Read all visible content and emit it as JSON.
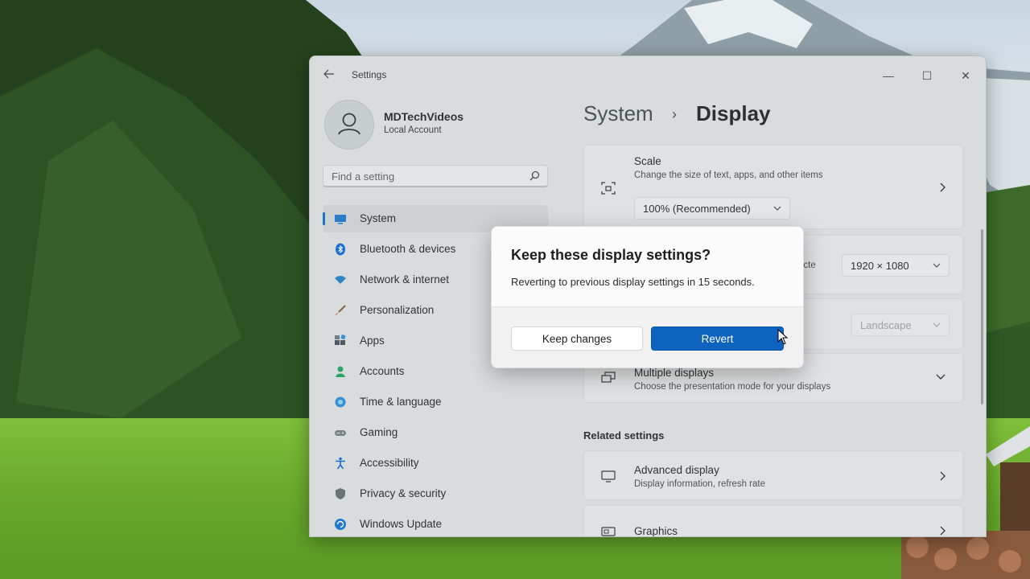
{
  "window": {
    "app_title": "Settings",
    "controls": {
      "minimize": "—",
      "maximize": "☐",
      "close": "✕"
    }
  },
  "profile": {
    "name": "MDTechVideos",
    "account_type": "Local Account"
  },
  "search": {
    "placeholder": "Find a setting"
  },
  "sidebar": {
    "items": [
      {
        "label": "System",
        "icon": "system-display-icon",
        "selected": true
      },
      {
        "label": "Bluetooth & devices",
        "icon": "bluetooth-icon"
      },
      {
        "label": "Network & internet",
        "icon": "wifi-icon"
      },
      {
        "label": "Personalization",
        "icon": "paintbrush-icon"
      },
      {
        "label": "Apps",
        "icon": "apps-grid-icon"
      },
      {
        "label": "Accounts",
        "icon": "person-icon"
      },
      {
        "label": "Time & language",
        "icon": "globe-clock-icon"
      },
      {
        "label": "Gaming",
        "icon": "gamepad-icon"
      },
      {
        "label": "Accessibility",
        "icon": "accessibility-icon"
      },
      {
        "label": "Privacy & security",
        "icon": "shield-icon"
      },
      {
        "label": "Windows Update",
        "icon": "update-icon"
      }
    ]
  },
  "breadcrumb": {
    "parent": "System",
    "separator": "›",
    "current": "Display"
  },
  "main": {
    "scale": {
      "title": "Scale",
      "subtitle": "Change the size of text, apps, and other items",
      "value": "100% (Recommended)"
    },
    "resolution": {
      "partial_label": "ecte",
      "value": "1920 × 1080"
    },
    "orientation": {
      "value": "Landscape"
    },
    "multiple_displays": {
      "title": "Multiple displays",
      "subtitle": "Choose the presentation mode for your displays"
    },
    "related_heading": "Related settings",
    "advanced_display": {
      "title": "Advanced display",
      "subtitle": "Display information, refresh rate"
    },
    "graphics": {
      "title": "Graphics"
    }
  },
  "dialog": {
    "title": "Keep these display settings?",
    "message": "Reverting to previous display settings in 15 seconds.",
    "keep_label": "Keep changes",
    "revert_label": "Revert"
  },
  "colors": {
    "accent": "#0d63bd",
    "selection_indicator": "#1f6fc2"
  }
}
